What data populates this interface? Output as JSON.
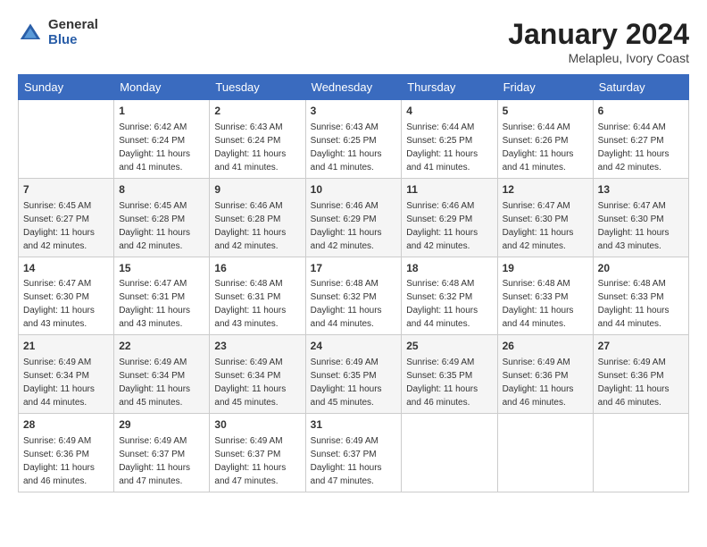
{
  "header": {
    "logo_general": "General",
    "logo_blue": "Blue",
    "title": "January 2024",
    "subtitle": "Melapleu, Ivory Coast"
  },
  "days_of_week": [
    "Sunday",
    "Monday",
    "Tuesday",
    "Wednesday",
    "Thursday",
    "Friday",
    "Saturday"
  ],
  "weeks": [
    [
      {
        "day": "",
        "sunrise": "",
        "sunset": "",
        "daylight": ""
      },
      {
        "day": "1",
        "sunrise": "Sunrise: 6:42 AM",
        "sunset": "Sunset: 6:24 PM",
        "daylight": "Daylight: 11 hours and 41 minutes."
      },
      {
        "day": "2",
        "sunrise": "Sunrise: 6:43 AM",
        "sunset": "Sunset: 6:24 PM",
        "daylight": "Daylight: 11 hours and 41 minutes."
      },
      {
        "day": "3",
        "sunrise": "Sunrise: 6:43 AM",
        "sunset": "Sunset: 6:25 PM",
        "daylight": "Daylight: 11 hours and 41 minutes."
      },
      {
        "day": "4",
        "sunrise": "Sunrise: 6:44 AM",
        "sunset": "Sunset: 6:25 PM",
        "daylight": "Daylight: 11 hours and 41 minutes."
      },
      {
        "day": "5",
        "sunrise": "Sunrise: 6:44 AM",
        "sunset": "Sunset: 6:26 PM",
        "daylight": "Daylight: 11 hours and 41 minutes."
      },
      {
        "day": "6",
        "sunrise": "Sunrise: 6:44 AM",
        "sunset": "Sunset: 6:27 PM",
        "daylight": "Daylight: 11 hours and 42 minutes."
      }
    ],
    [
      {
        "day": "7",
        "sunrise": "Sunrise: 6:45 AM",
        "sunset": "Sunset: 6:27 PM",
        "daylight": "Daylight: 11 hours and 42 minutes."
      },
      {
        "day": "8",
        "sunrise": "Sunrise: 6:45 AM",
        "sunset": "Sunset: 6:28 PM",
        "daylight": "Daylight: 11 hours and 42 minutes."
      },
      {
        "day": "9",
        "sunrise": "Sunrise: 6:46 AM",
        "sunset": "Sunset: 6:28 PM",
        "daylight": "Daylight: 11 hours and 42 minutes."
      },
      {
        "day": "10",
        "sunrise": "Sunrise: 6:46 AM",
        "sunset": "Sunset: 6:29 PM",
        "daylight": "Daylight: 11 hours and 42 minutes."
      },
      {
        "day": "11",
        "sunrise": "Sunrise: 6:46 AM",
        "sunset": "Sunset: 6:29 PM",
        "daylight": "Daylight: 11 hours and 42 minutes."
      },
      {
        "day": "12",
        "sunrise": "Sunrise: 6:47 AM",
        "sunset": "Sunset: 6:30 PM",
        "daylight": "Daylight: 11 hours and 42 minutes."
      },
      {
        "day": "13",
        "sunrise": "Sunrise: 6:47 AM",
        "sunset": "Sunset: 6:30 PM",
        "daylight": "Daylight: 11 hours and 43 minutes."
      }
    ],
    [
      {
        "day": "14",
        "sunrise": "Sunrise: 6:47 AM",
        "sunset": "Sunset: 6:30 PM",
        "daylight": "Daylight: 11 hours and 43 minutes."
      },
      {
        "day": "15",
        "sunrise": "Sunrise: 6:47 AM",
        "sunset": "Sunset: 6:31 PM",
        "daylight": "Daylight: 11 hours and 43 minutes."
      },
      {
        "day": "16",
        "sunrise": "Sunrise: 6:48 AM",
        "sunset": "Sunset: 6:31 PM",
        "daylight": "Daylight: 11 hours and 43 minutes."
      },
      {
        "day": "17",
        "sunrise": "Sunrise: 6:48 AM",
        "sunset": "Sunset: 6:32 PM",
        "daylight": "Daylight: 11 hours and 44 minutes."
      },
      {
        "day": "18",
        "sunrise": "Sunrise: 6:48 AM",
        "sunset": "Sunset: 6:32 PM",
        "daylight": "Daylight: 11 hours and 44 minutes."
      },
      {
        "day": "19",
        "sunrise": "Sunrise: 6:48 AM",
        "sunset": "Sunset: 6:33 PM",
        "daylight": "Daylight: 11 hours and 44 minutes."
      },
      {
        "day": "20",
        "sunrise": "Sunrise: 6:48 AM",
        "sunset": "Sunset: 6:33 PM",
        "daylight": "Daylight: 11 hours and 44 minutes."
      }
    ],
    [
      {
        "day": "21",
        "sunrise": "Sunrise: 6:49 AM",
        "sunset": "Sunset: 6:34 PM",
        "daylight": "Daylight: 11 hours and 44 minutes."
      },
      {
        "day": "22",
        "sunrise": "Sunrise: 6:49 AM",
        "sunset": "Sunset: 6:34 PM",
        "daylight": "Daylight: 11 hours and 45 minutes."
      },
      {
        "day": "23",
        "sunrise": "Sunrise: 6:49 AM",
        "sunset": "Sunset: 6:34 PM",
        "daylight": "Daylight: 11 hours and 45 minutes."
      },
      {
        "day": "24",
        "sunrise": "Sunrise: 6:49 AM",
        "sunset": "Sunset: 6:35 PM",
        "daylight": "Daylight: 11 hours and 45 minutes."
      },
      {
        "day": "25",
        "sunrise": "Sunrise: 6:49 AM",
        "sunset": "Sunset: 6:35 PM",
        "daylight": "Daylight: 11 hours and 46 minutes."
      },
      {
        "day": "26",
        "sunrise": "Sunrise: 6:49 AM",
        "sunset": "Sunset: 6:36 PM",
        "daylight": "Daylight: 11 hours and 46 minutes."
      },
      {
        "day": "27",
        "sunrise": "Sunrise: 6:49 AM",
        "sunset": "Sunset: 6:36 PM",
        "daylight": "Daylight: 11 hours and 46 minutes."
      }
    ],
    [
      {
        "day": "28",
        "sunrise": "Sunrise: 6:49 AM",
        "sunset": "Sunset: 6:36 PM",
        "daylight": "Daylight: 11 hours and 46 minutes."
      },
      {
        "day": "29",
        "sunrise": "Sunrise: 6:49 AM",
        "sunset": "Sunset: 6:37 PM",
        "daylight": "Daylight: 11 hours and 47 minutes."
      },
      {
        "day": "30",
        "sunrise": "Sunrise: 6:49 AM",
        "sunset": "Sunset: 6:37 PM",
        "daylight": "Daylight: 11 hours and 47 minutes."
      },
      {
        "day": "31",
        "sunrise": "Sunrise: 6:49 AM",
        "sunset": "Sunset: 6:37 PM",
        "daylight": "Daylight: 11 hours and 47 minutes."
      },
      {
        "day": "",
        "sunrise": "",
        "sunset": "",
        "daylight": ""
      },
      {
        "day": "",
        "sunrise": "",
        "sunset": "",
        "daylight": ""
      },
      {
        "day": "",
        "sunrise": "",
        "sunset": "",
        "daylight": ""
      }
    ]
  ]
}
